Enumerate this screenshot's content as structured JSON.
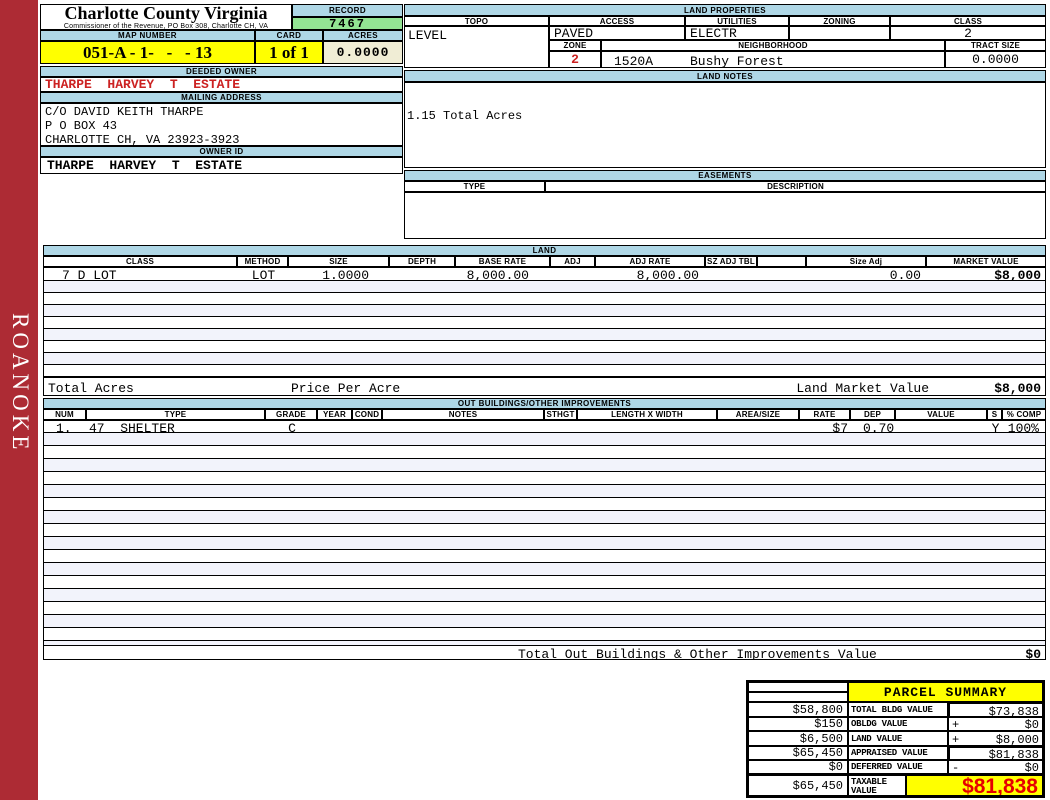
{
  "colors": {
    "section_header_blue": "#afd7e6",
    "record_green": "#93e493",
    "highlight_yellow": "#ffff00",
    "acres_ivory": "#f0edd5",
    "owner_red": "#cc2222",
    "taxable_red": "#e60000",
    "sidebar_red": "#ad2b34",
    "stripe_lavender": "#f2f3fb"
  },
  "sidebar": {
    "locality": "ROANOKE"
  },
  "header": {
    "county": "Charlotte County Virginia",
    "commissioner": "Commissioner of the Revenue, PO Box 308, Charlotte CH, VA",
    "record_label": "RECORD",
    "record_value": "7467",
    "map_number_label": "MAP NUMBER",
    "map_number": "051-A - 1-   -   - 13",
    "card_label": "CARD",
    "card": "1 of 1",
    "acres_label": "ACRES",
    "acres": "0.0000"
  },
  "owner": {
    "deeded_owner_label": "DEEDED OWNER",
    "deeded_owner": "THARPE  HARVEY  T  ESTATE",
    "mailing_address_label": "MAILING ADDRESS",
    "address_line1": "C/O DAVID KEITH THARPE",
    "address_line2": "P O BOX 43",
    "address_line3": "CHARLOTTE CH, VA 23923-3923",
    "owner_id_label": "OWNER ID",
    "owner_id": "THARPE  HARVEY  T  ESTATE"
  },
  "land_properties": {
    "title": "LAND PROPERTIES",
    "topo_label": "TOPO",
    "topo": "LEVEL",
    "access_label": "ACCESS",
    "access": "PAVED",
    "utilities_label": "UTILITIES",
    "utilities": "ELECTR",
    "zoning_label": "ZONING",
    "zoning": "",
    "class_label": "CLASS",
    "class": "2",
    "zone_label": "ZONE",
    "zone": "2",
    "neighborhood_label": "NEIGHBORHOOD",
    "neighborhood_code": "1520A",
    "neighborhood": "Bushy Forest",
    "tract_size_label": "TRACT SIZE",
    "tract_size": "0.0000"
  },
  "land_notes": {
    "title": "LAND NOTES",
    "note": "1.15 Total Acres"
  },
  "easements": {
    "title": "EASEMENTS",
    "type_label": "TYPE",
    "description_label": "DESCRIPTION"
  },
  "land": {
    "title": "LAND",
    "columns": [
      "CLASS",
      "METHOD",
      "SIZE",
      "DEPTH",
      "BASE RATE",
      "ADJ",
      "ADJ RATE",
      "SZ ADJ TBL",
      "",
      "Size Adj",
      "MARKET VALUE"
    ],
    "row": {
      "class": "7 D LOT",
      "method": "LOT",
      "size": "1.0000",
      "depth": "",
      "base_rate": "8,000.00",
      "adj": "",
      "adj_rate": "8,000.00",
      "sz_adj_tbl": "",
      "size_adj": "0.00",
      "market_value": "$8,000"
    },
    "total_acres_label": "Total Acres",
    "price_per_acre_label": "Price Per Acre",
    "land_market_value_label": "Land Market Value",
    "land_market_value": "$8,000"
  },
  "out_buildings": {
    "title": "OUT BUILDINGS/OTHER IMPROVEMENTS",
    "columns": [
      "NUM",
      "TYPE",
      "GRADE",
      "YEAR",
      "COND",
      "NOTES",
      "STHGT",
      "LENGTH X WIDTH",
      "AREA/SIZE",
      "RATE",
      "DEP",
      "VALUE",
      "S",
      "% COMP"
    ],
    "row": {
      "num": "1.",
      "type": "47  SHELTER",
      "grade": "C",
      "rate": "$7",
      "dep": "0.70",
      "s": "Y",
      "pct_comp": "100%"
    },
    "total_label": "Total Out Buildings & Other Improvements Value",
    "total_value": "$0"
  },
  "parcel_summary": {
    "title": "PARCEL SUMMARY",
    "rows": [
      {
        "prior": "$58,800",
        "label": "TOTAL BLDG VALUE",
        "sign": "",
        "value": "$73,838"
      },
      {
        "prior": "$150",
        "label": "OBLDG VALUE",
        "sign": "+",
        "value": "$0"
      },
      {
        "prior": "$6,500",
        "label": "LAND VALUE",
        "sign": "+",
        "value": "$8,000"
      },
      {
        "prior": "$65,450",
        "label": "APPRAISED VALUE",
        "sign": "",
        "value": "$81,838"
      },
      {
        "prior": "$0",
        "label": "DEFERRED VALUE",
        "sign": "-",
        "value": "$0"
      },
      {
        "prior": "$65,450",
        "label": "TAXABLE VALUE",
        "sign": "",
        "value": "$81,838"
      }
    ]
  }
}
